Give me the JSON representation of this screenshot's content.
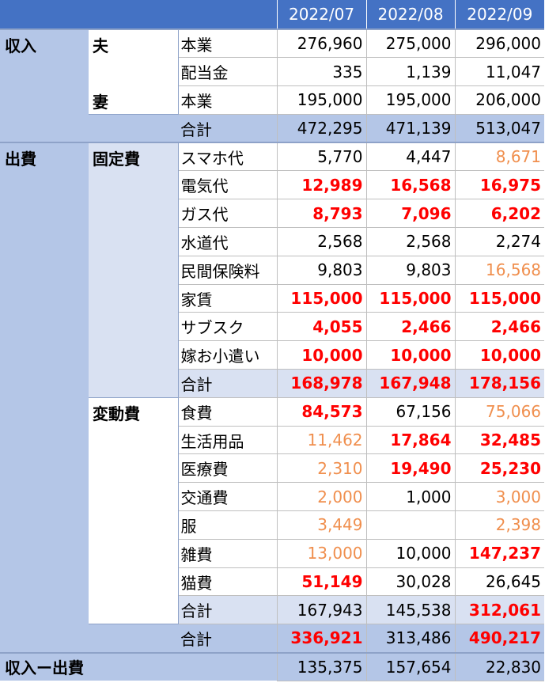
{
  "header": {
    "months": [
      "2022/07",
      "2022/08",
      "2022/09"
    ]
  },
  "income": {
    "label": "収入",
    "husband": {
      "label": "夫",
      "rows": [
        {
          "item": "本業",
          "values": [
            "276,960",
            "275,000",
            "296,000"
          ],
          "styles": [
            "n",
            "n",
            "n"
          ]
        },
        {
          "item": "配当金",
          "values": [
            "335",
            "1,139",
            "11,047"
          ],
          "styles": [
            "n",
            "n",
            "n"
          ]
        }
      ]
    },
    "wife": {
      "label": "妻",
      "rows": [
        {
          "item": "本業",
          "values": [
            "195,000",
            "195,000",
            "206,000"
          ],
          "styles": [
            "n",
            "n",
            "n"
          ]
        }
      ]
    },
    "total": {
      "item": "合計",
      "values": [
        "472,295",
        "471,139",
        "513,047"
      ],
      "styles": [
        "n",
        "n",
        "n"
      ]
    }
  },
  "expense": {
    "label": "出費",
    "fixed": {
      "label": "固定費",
      "rows": [
        {
          "item": "スマホ代",
          "values": [
            "5,770",
            "4,447",
            "8,671"
          ],
          "styles": [
            "n",
            "n",
            "o"
          ]
        },
        {
          "item": "電気代",
          "values": [
            "12,989",
            "16,568",
            "16,975"
          ],
          "styles": [
            "r",
            "r",
            "r"
          ]
        },
        {
          "item": "ガス代",
          "values": [
            "8,793",
            "7,096",
            "6,202"
          ],
          "styles": [
            "r",
            "r",
            "r"
          ]
        },
        {
          "item": "水道代",
          "values": [
            "2,568",
            "2,568",
            "2,274"
          ],
          "styles": [
            "n",
            "n",
            "n"
          ]
        },
        {
          "item": "民間保険料",
          "values": [
            "9,803",
            "9,803",
            "16,568"
          ],
          "styles": [
            "n",
            "n",
            "o"
          ]
        },
        {
          "item": "家賃",
          "values": [
            "115,000",
            "115,000",
            "115,000"
          ],
          "styles": [
            "r",
            "r",
            "r"
          ]
        },
        {
          "item": "サブスク",
          "values": [
            "4,055",
            "2,466",
            "2,466"
          ],
          "styles": [
            "r",
            "r",
            "r"
          ]
        },
        {
          "item": "嫁お小遣い",
          "values": [
            "10,000",
            "10,000",
            "10,000"
          ],
          "styles": [
            "r",
            "r",
            "r"
          ]
        }
      ],
      "total": {
        "item": "合計",
        "values": [
          "168,978",
          "167,948",
          "178,156"
        ],
        "styles": [
          "r",
          "r",
          "r"
        ]
      }
    },
    "variable": {
      "label": "変動費",
      "rows": [
        {
          "item": "食費",
          "values": [
            "84,573",
            "67,156",
            "75,066"
          ],
          "styles": [
            "r",
            "n",
            "o"
          ]
        },
        {
          "item": "生活用品",
          "values": [
            "11,462",
            "17,864",
            "32,485"
          ],
          "styles": [
            "o",
            "r",
            "r"
          ]
        },
        {
          "item": "医療費",
          "values": [
            "2,310",
            "19,490",
            "25,230"
          ],
          "styles": [
            "o",
            "r",
            "r"
          ]
        },
        {
          "item": "交通費",
          "values": [
            "2,000",
            "1,000",
            "3,000"
          ],
          "styles": [
            "o",
            "n",
            "o"
          ]
        },
        {
          "item": "服",
          "values": [
            "3,449",
            "",
            "2,398"
          ],
          "styles": [
            "o",
            "n",
            "o"
          ]
        },
        {
          "item": "雑費",
          "values": [
            "13,000",
            "10,000",
            "147,237"
          ],
          "styles": [
            "o",
            "n",
            "r"
          ]
        },
        {
          "item": "猫費",
          "values": [
            "51,149",
            "30,028",
            "26,645"
          ],
          "styles": [
            "r",
            "n",
            "n"
          ]
        }
      ],
      "total": {
        "item": "合計",
        "values": [
          "167,943",
          "145,538",
          "312,061"
        ],
        "styles": [
          "n",
          "n",
          "r"
        ]
      }
    },
    "total": {
      "item": "合計",
      "values": [
        "336,921",
        "313,486",
        "490,217"
      ],
      "styles": [
        "r",
        "n",
        "r"
      ]
    }
  },
  "net": {
    "label": "収入ー出費",
    "values": [
      "135,375",
      "157,654",
      "22,830"
    ],
    "styles": [
      "n",
      "n",
      "n"
    ]
  },
  "colors": {
    "header_bg": "#4472c4",
    "section_bg": "#b4c6e7",
    "sub_bg": "#d9e1f2",
    "red": "#ff0000",
    "orange": "#f08f4e"
  }
}
